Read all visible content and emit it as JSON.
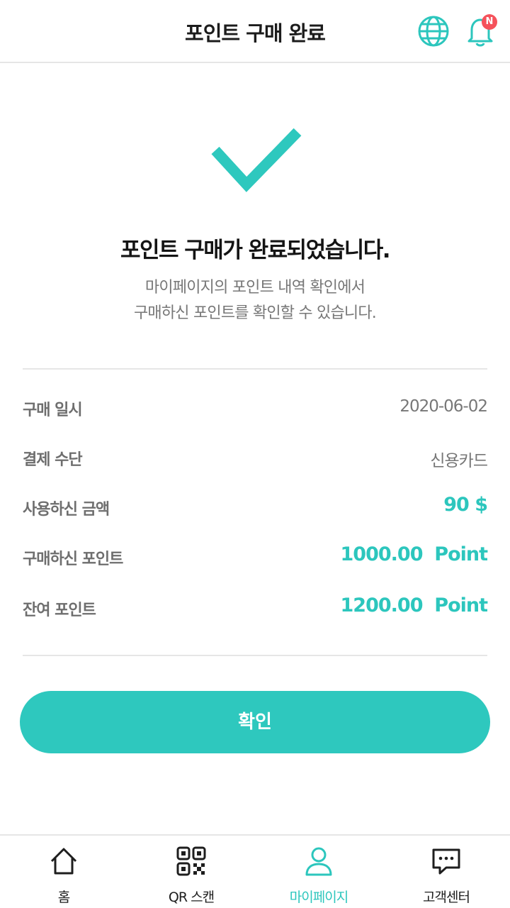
{
  "header": {
    "title": "포인트 구매 완료",
    "globe_icon": "globe-icon",
    "bell_icon": "bell-icon",
    "notification_badge": "N"
  },
  "message": {
    "title": "포인트 구매가 완료되었습니다.",
    "line1": "마이페이지의 포인트 내역 확인에서",
    "line2": "구매하신 포인트를 확인할 수 있습니다."
  },
  "details": [
    {
      "label": "구매 일시",
      "value": "2020-06-02"
    },
    {
      "label": "결제 수단",
      "value": "신용카드"
    },
    {
      "label": "사용하신 금액",
      "value": "90 $"
    },
    {
      "label": "구매하신 포인트",
      "value": "1000.00  Point"
    },
    {
      "label": "잔여 포인트",
      "value": "1200.00  Point"
    }
  ],
  "confirm_button": "확인",
  "bottom_nav": [
    {
      "label": "홈",
      "icon": "home-icon"
    },
    {
      "label": "QR 스캔",
      "icon": "qr-icon"
    },
    {
      "label": "마이페이지",
      "icon": "user-icon",
      "active": true
    },
    {
      "label": "고객센터",
      "icon": "chat-icon"
    }
  ],
  "colors": {
    "accent": "#2ec8be",
    "badge": "#f5525b",
    "label": "#6e6e6e",
    "divider": "#e6e6e6"
  }
}
